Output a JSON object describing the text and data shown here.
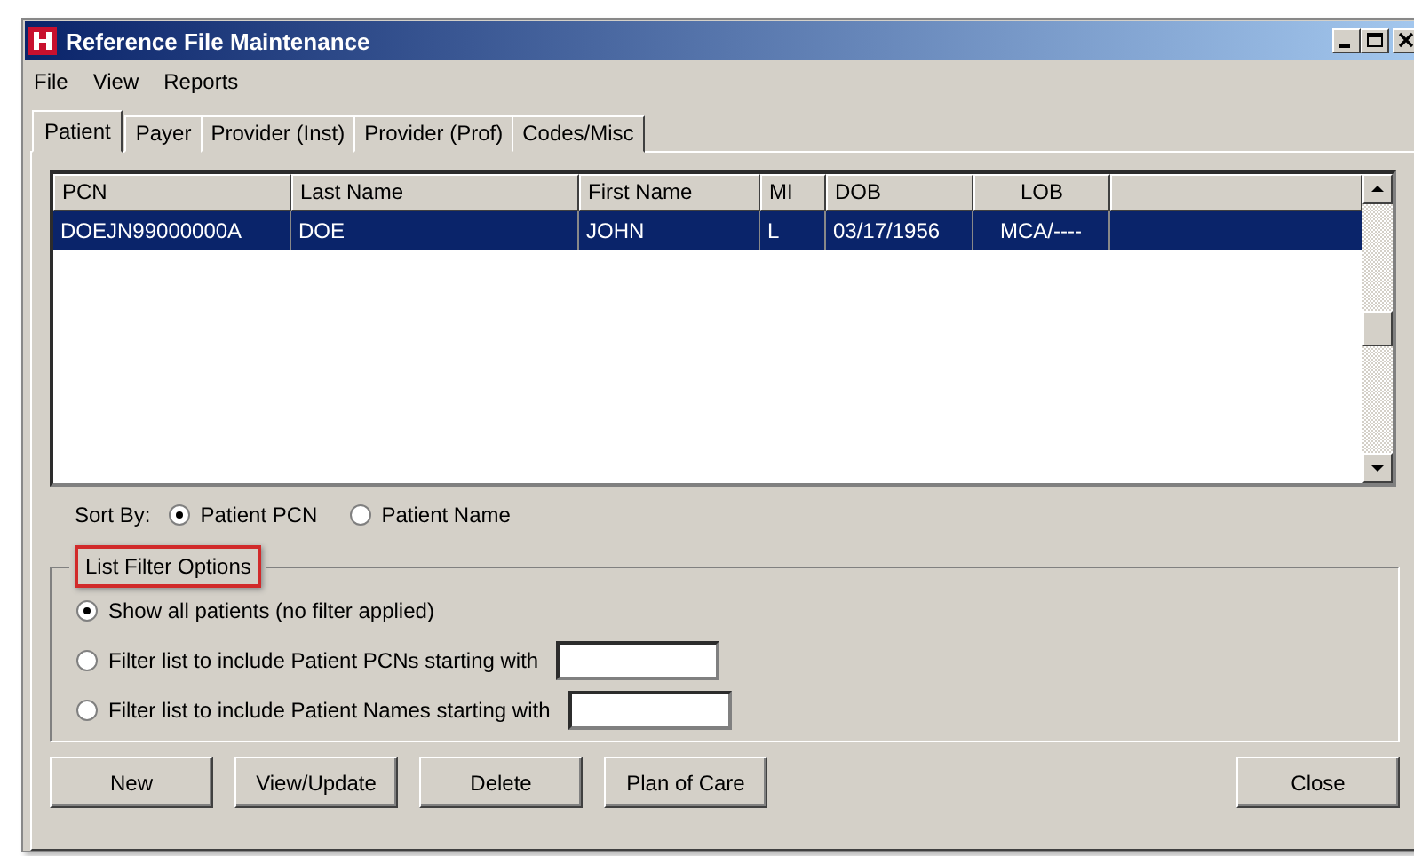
{
  "window": {
    "title": "Reference File Maintenance"
  },
  "menu": [
    "File",
    "View",
    "Reports"
  ],
  "tabs": [
    {
      "label": "Patient",
      "selected": true
    },
    {
      "label": "Payer",
      "selected": false
    },
    {
      "label": "Provider (Inst)",
      "selected": false
    },
    {
      "label": "Provider (Prof)",
      "selected": false
    },
    {
      "label": "Codes/Misc",
      "selected": false
    }
  ],
  "table": {
    "columns": [
      {
        "label": "PCN",
        "centered": false
      },
      {
        "label": "Last Name",
        "centered": false
      },
      {
        "label": "First Name",
        "centered": false
      },
      {
        "label": "MI",
        "centered": false
      },
      {
        "label": "DOB",
        "centered": false
      },
      {
        "label": "LOB",
        "centered": true
      }
    ],
    "rows": [
      {
        "cells": [
          "DOEJN99000000A",
          "DOE",
          "JOHN",
          "L",
          "03/17/1956",
          "MCA/----"
        ],
        "selected": true
      }
    ]
  },
  "sort_by": {
    "label": "Sort By:",
    "options": [
      {
        "label": "Patient PCN",
        "selected": true
      },
      {
        "label": "Patient Name",
        "selected": false
      }
    ]
  },
  "filter_group": {
    "legend": "List Filter Options",
    "highlighted": true,
    "options": [
      {
        "label": "Show all patients (no filter applied)",
        "selected": true,
        "kind": "plain"
      },
      {
        "label": "Filter list to include Patient PCNs starting with",
        "selected": false,
        "kind": "input"
      },
      {
        "label": "Filter list to include Patient Names starting with",
        "selected": false,
        "kind": "input"
      }
    ]
  },
  "buttons": [
    {
      "label": "New",
      "kind": "left"
    },
    {
      "label": "View/Update",
      "kind": "left"
    },
    {
      "label": "Delete",
      "kind": "left"
    },
    {
      "label": "Plan of Care",
      "kind": "left"
    },
    {
      "label": "Close",
      "kind": "right"
    }
  ]
}
